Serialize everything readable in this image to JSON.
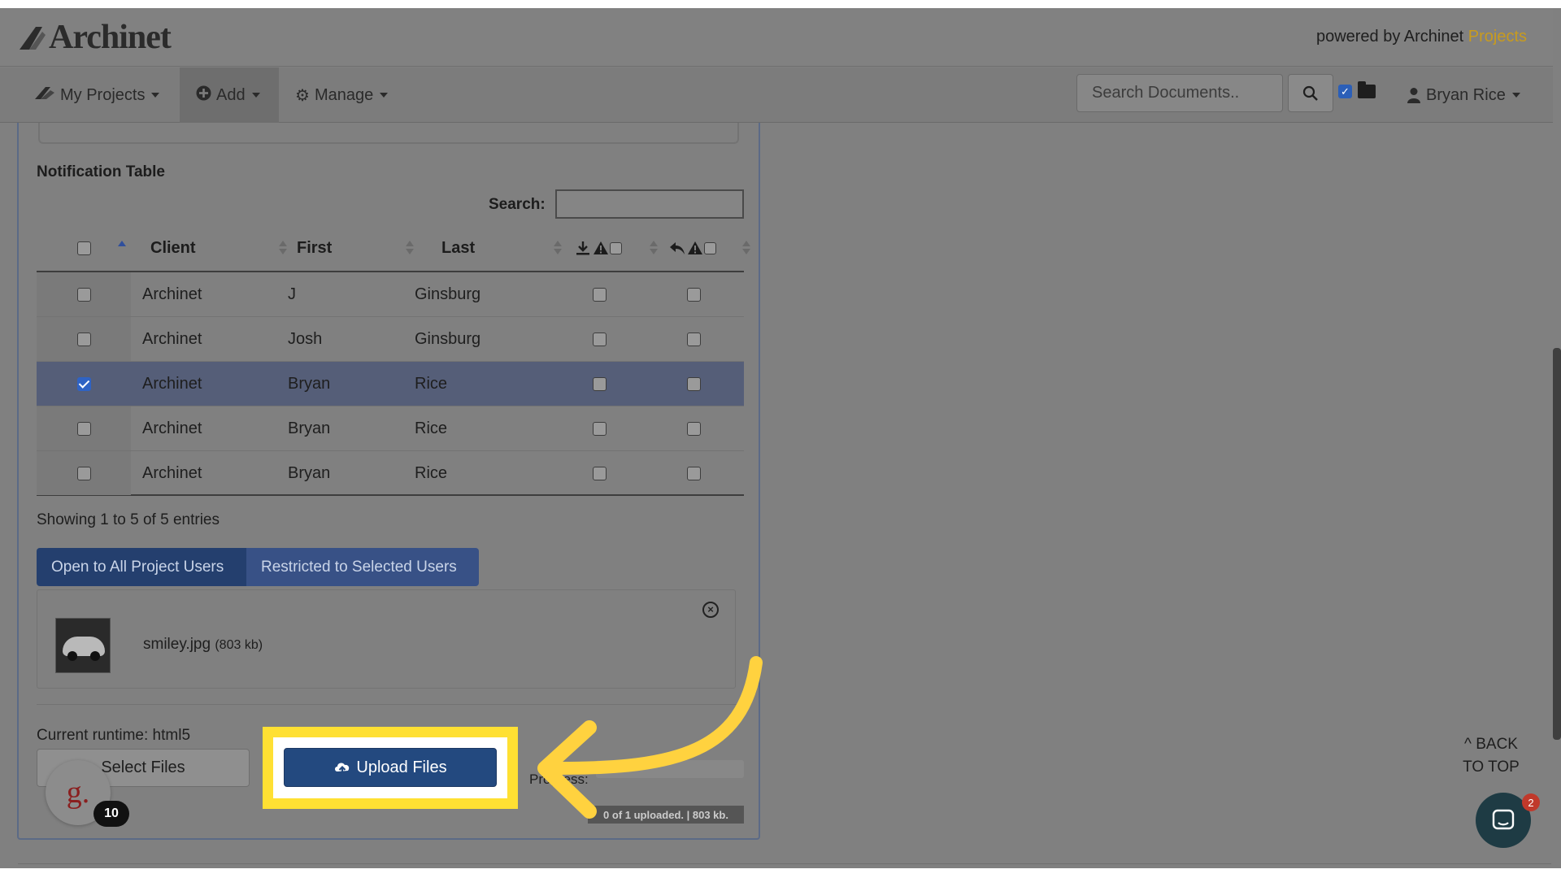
{
  "header": {
    "logo_text": "Archinet",
    "powered_prefix": "powered by Archinet",
    "powered_suffix": "Projects"
  },
  "nav": {
    "my_projects": "My Projects",
    "add": "Add",
    "manage": "Manage",
    "search_placeholder": "Search Documents..",
    "user": "Bryan Rice"
  },
  "panel": {
    "title": "Notification Table",
    "search_label": "Search:",
    "columns": [
      "Client",
      "First",
      "Last"
    ],
    "rows": [
      {
        "client": "Archinet",
        "first": "J",
        "last": "Ginsburg",
        "selected": false
      },
      {
        "client": "Archinet",
        "first": "Josh",
        "last": "Ginsburg",
        "selected": false
      },
      {
        "client": "Archinet",
        "first": "Bryan",
        "last": "Rice",
        "selected": true
      },
      {
        "client": "Archinet",
        "first": "Bryan",
        "last": "Rice",
        "selected": false
      },
      {
        "client": "Archinet",
        "first": "Bryan",
        "last": "Rice",
        "selected": false
      }
    ],
    "showing": "Showing 1 to 5 of 5 entries",
    "access_open": "Open to All Project Users",
    "access_restricted": "Restricted to Selected Users",
    "file_name": "smiley.jpg",
    "file_size": "(803 kb)",
    "runtime": "Current runtime: html5",
    "select_files": "Select Files",
    "upload_files": "Upload Files",
    "progress_label": "Progress:",
    "progress_status": "0 of 1 uploaded. | 803 kb."
  },
  "widgets": {
    "avatar_letter": "g.",
    "avatar_badge": "10",
    "back_to_top_line1": "BACK",
    "back_to_top_line2": "TO TOP",
    "chat_badge": "2"
  },
  "colors": {
    "accent_blue": "#23497f",
    "highlight_yellow": "#ffe033",
    "brand_gold": "#c89b1e"
  }
}
